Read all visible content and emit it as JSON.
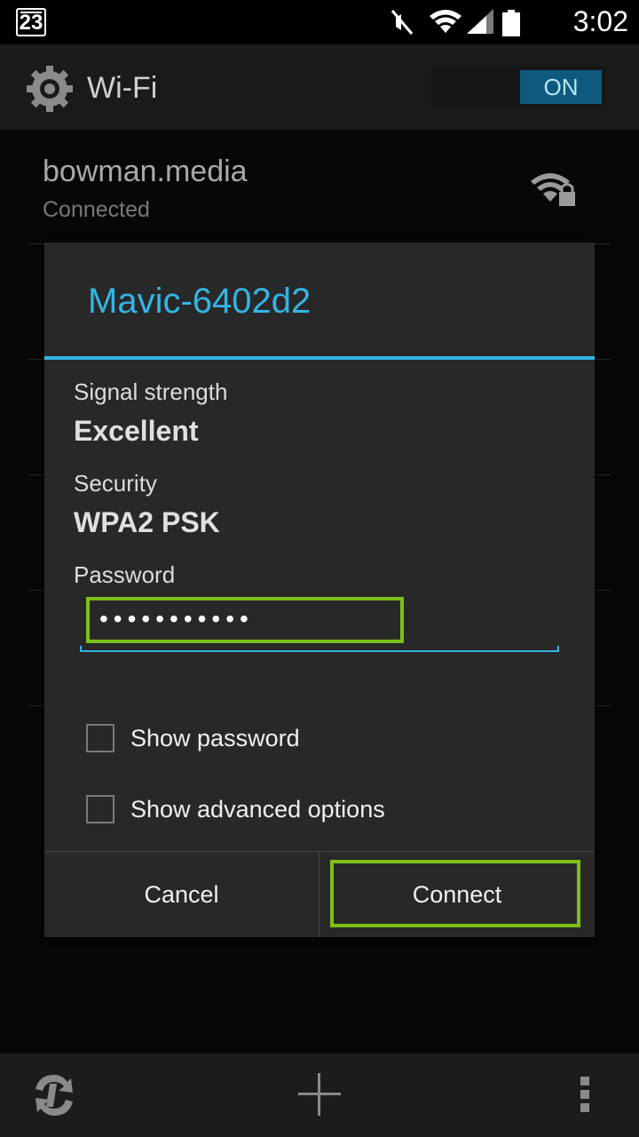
{
  "status_bar": {
    "notification_badge": "23",
    "time": "3:02",
    "icons": [
      "mute-icon",
      "wifi-icon",
      "cell-signal-icon",
      "battery-icon"
    ]
  },
  "action_bar": {
    "icon": "settings-gear-icon",
    "title": "Wi-Fi",
    "toggle_label": "ON"
  },
  "networks": [
    {
      "name": "bowman.media",
      "status": "Connected",
      "icon": "wifi-secured-icon"
    }
  ],
  "dialog": {
    "title": "Mavic-6402d2",
    "signal_label": "Signal strength",
    "signal_value": "Excellent",
    "security_label": "Security",
    "security_value": "WPA2 PSK",
    "password_label": "Password",
    "password_value": "•••••••••••",
    "show_password_label": "Show password",
    "show_advanced_label": "Show advanced options",
    "cancel_label": "Cancel",
    "connect_label": "Connect"
  },
  "bottom_bar": {
    "icons": [
      "wps-icon",
      "add-network-icon",
      "overflow-menu-icon"
    ]
  },
  "colors": {
    "accent": "#33b5e5",
    "highlight": "#7cc019"
  }
}
